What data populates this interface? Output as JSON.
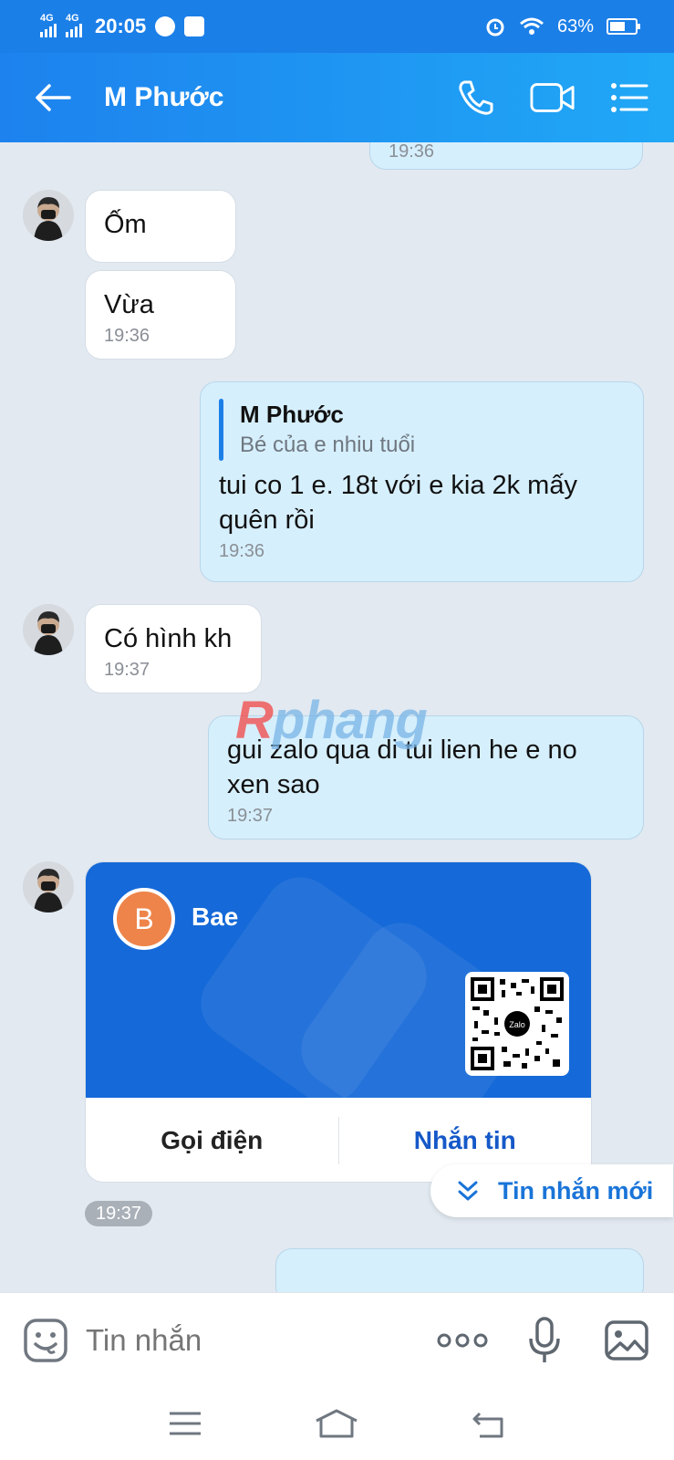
{
  "status_bar": {
    "net1": "4G",
    "net2": "4G",
    "time": "20:05",
    "battery": "63%",
    "battery_level": 0.63
  },
  "header": {
    "contact_name": "M Phước",
    "icons": [
      "back-arrow-icon",
      "phone-icon",
      "video-call-icon",
      "menu-list-icon"
    ]
  },
  "messages": {
    "m0": {
      "time": "19:36"
    },
    "m1": {
      "text": "Ốm"
    },
    "m2": {
      "text": "Vừa",
      "time": "19:36"
    },
    "m3": {
      "quote_name": "M Phước",
      "quote_text": "Bé của e nhiu tuổi",
      "text": "tui co 1 e. 18t với e kia 2k mấy quên rồi",
      "time": "19:36"
    },
    "m4": {
      "text": "Có hình kh",
      "time": "19:37"
    },
    "m5": {
      "text": "gui zalo qua di tui lien he e no xen sao",
      "time": "19:37"
    },
    "card": {
      "avatar_letter": "B",
      "name": "Bae",
      "qr_logo": "Zalo",
      "call_label": "Gọi điện",
      "message_label": "Nhắn tin",
      "time": "19:37"
    }
  },
  "new_message_label": "Tin nhắn mới",
  "watermark": {
    "r": "R",
    "rest": "phang"
  },
  "input": {
    "placeholder": "Tin nhắn",
    "icons": [
      "emoji-icon",
      "more-icon",
      "microphone-icon",
      "image-icon"
    ]
  },
  "nav": {
    "icons": [
      "recent-apps-icon",
      "home-icon",
      "back-icon"
    ]
  },
  "colors": {
    "header": "#1b7fe8",
    "incoming_bubble": "#ffffff",
    "outgoing_bubble": "#d6effd",
    "card_blue": "#1569d8",
    "card_avatar": "#ee844a"
  }
}
